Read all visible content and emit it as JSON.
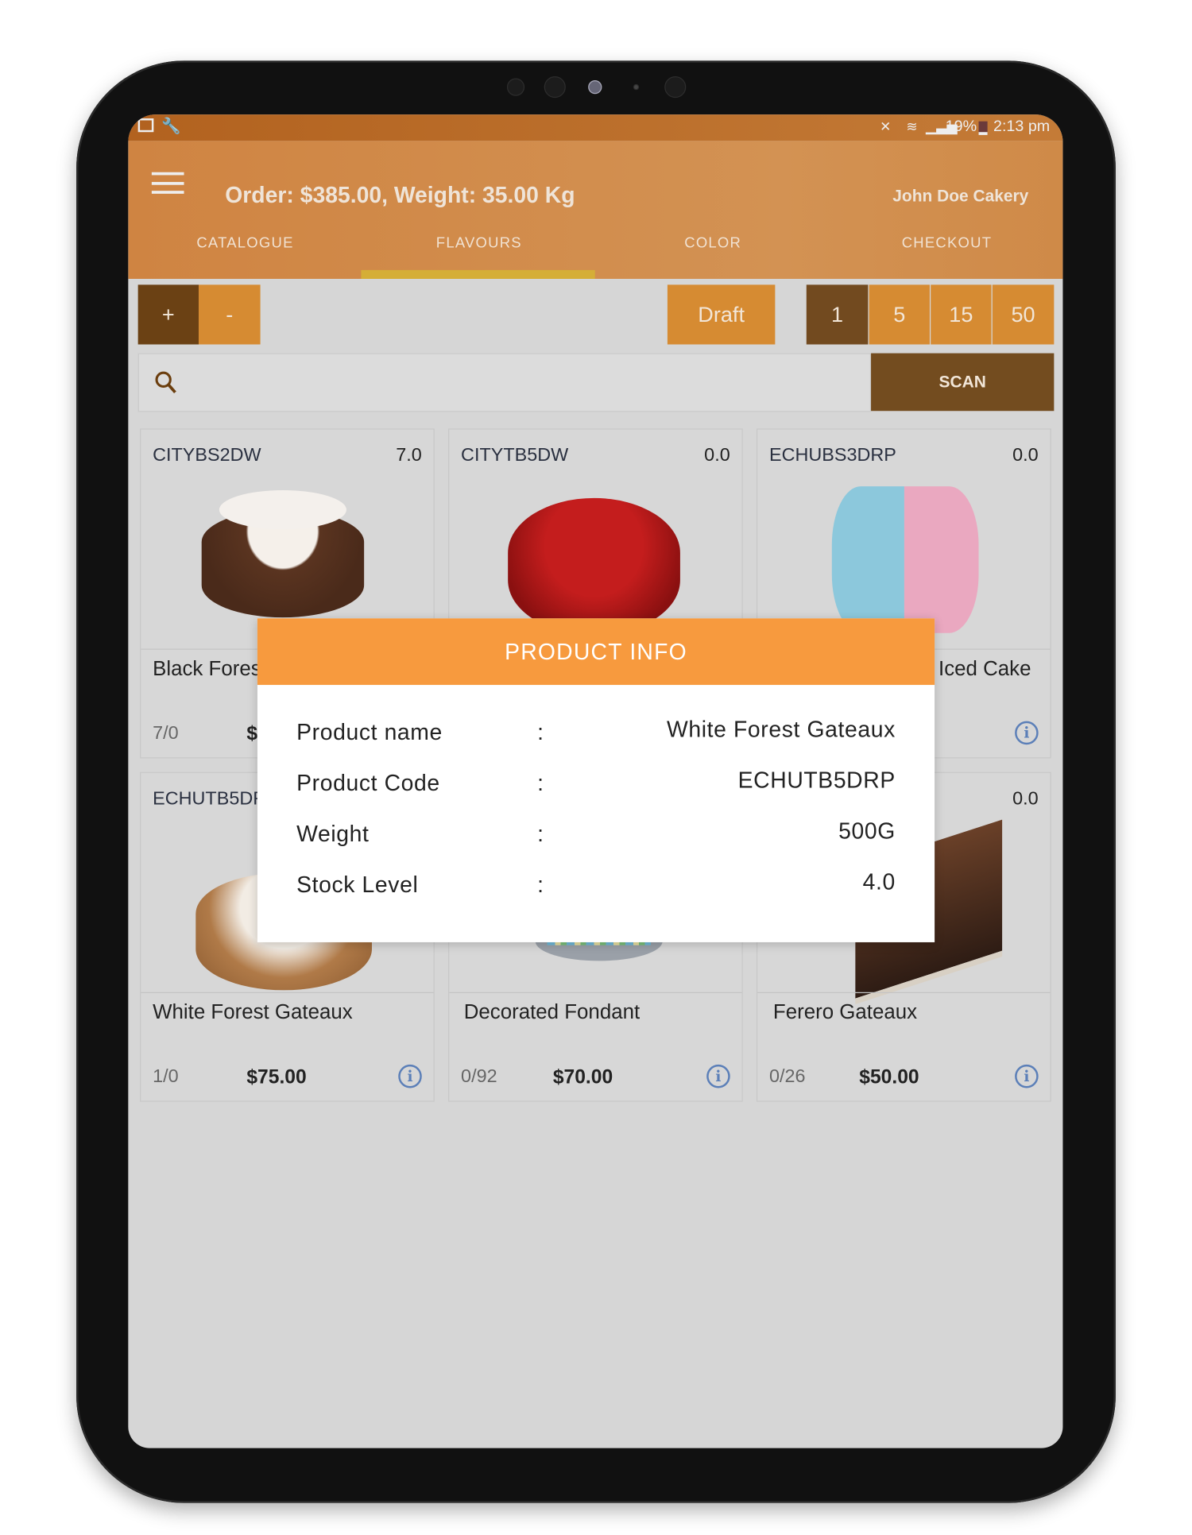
{
  "status_bar": {
    "battery": "19%",
    "time": "2:13 pm"
  },
  "header": {
    "title": "Order: $385.00, Weight: 35.00 Kg",
    "brand": "John Doe Cakery"
  },
  "tabs": [
    {
      "label": "CATALOGUE"
    },
    {
      "label": "FLAVOURS",
      "active": true
    },
    {
      "label": "COLOR"
    },
    {
      "label": "CHECKOUT"
    }
  ],
  "toolbar": {
    "plus": "+",
    "minus": "-",
    "draft": "Draft",
    "quantities": [
      "1",
      "5",
      "15",
      "50"
    ],
    "selected_quantity": "1",
    "scan": "SCAN"
  },
  "search": {
    "placeholder": ""
  },
  "products": [
    {
      "code": "CITYBS2DW",
      "qty": "7.0",
      "name": "Black Fores",
      "stock": "7/0",
      "price": "$"
    },
    {
      "code": "CITYTB5DW",
      "qty": "0.0",
      "name": "",
      "stock": "",
      "price": ""
    },
    {
      "code": "ECHUBS3DRP",
      "qty": "0.0",
      "name": "Iced Cake",
      "stock": "",
      "price": ""
    },
    {
      "code": "ECHUTB5DF",
      "qty": "",
      "name": "White Forest Gateaux",
      "stock": "1/0",
      "price": "$75.00"
    },
    {
      "code": "",
      "qty": "",
      "name": "Decorated Fondant",
      "stock": "0/92",
      "price": "$70.00"
    },
    {
      "code": "",
      "qty": "0.0",
      "name": "Ferero Gateaux",
      "stock": "0/26",
      "price": "$50.00"
    }
  ],
  "dialog": {
    "title": "PRODUCT INFO",
    "rows": [
      {
        "label": "Product name",
        "sep": ":",
        "value": "White Forest Gateaux"
      },
      {
        "label": "Product Code",
        "sep": ":",
        "value": "ECHUTB5DRP"
      },
      {
        "label": "Weight",
        "sep": ":",
        "value": "500G"
      },
      {
        "label": "Stock Level",
        "sep": ":",
        "value": "4.0"
      }
    ]
  },
  "colors": {
    "appbar": "#d08a45",
    "tab_indicator": "#d5ae37",
    "dark_button": "#6b4114",
    "orange_button": "#d68b32",
    "dialog_header": "#f79a3e",
    "info_icon": "#5b7fb8"
  }
}
